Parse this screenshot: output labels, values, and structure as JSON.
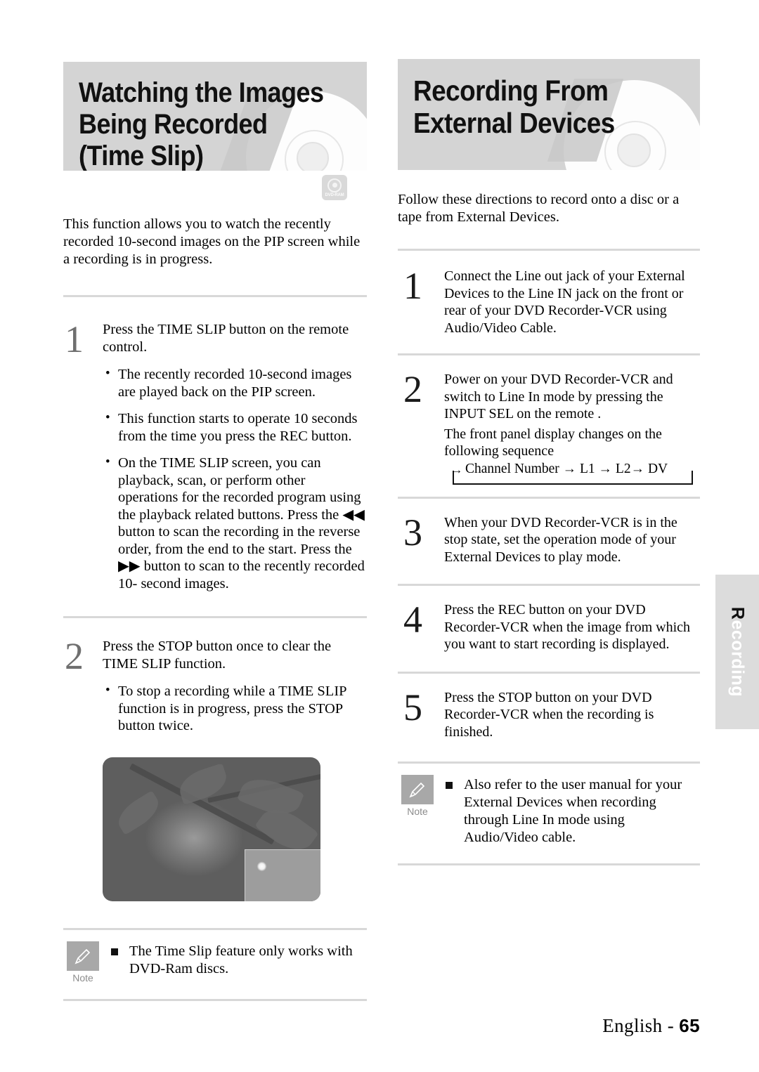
{
  "page": {
    "footer_prefix": "English - ",
    "footer_page": "65",
    "side_tab_text": "Recording",
    "side_tab_initial": "R",
    "side_tab_rest": "ecording"
  },
  "left": {
    "banner_title": "Watching the Images\nBeing Recorded (Time Slip)",
    "disc_badge": {
      "label": "DVD-RAM",
      "icon": "dvd-ram-disc-icon"
    },
    "intro": "This function allows you to watch the recently recorded 10-second images on the PIP screen while a recording is in progress.",
    "steps": [
      {
        "number": "1",
        "lead": "Press the TIME SLIP button on the remote control.",
        "bullets": [
          "The recently recorded 10-second images are played back on the PIP screen.",
          "This function starts to operate 10 seconds from the time you press the REC button.",
          "On the TIME SLIP screen, you can playback, scan, or perform other operations for the recorded program using the playback related buttons. Press the ◀◀ button to scan the recording in the reverse order, from the end to the start. Press the ▶▶ button to scan to the recently recorded  10- second images."
        ]
      },
      {
        "number": "2",
        "lead": "Press the STOP button once to clear the TIME SLIP function.",
        "bullets": [
          "To stop a recording while a TIME SLIP function is in progress, press the STOP button twice."
        ]
      }
    ],
    "photo": {
      "alt": "Grayscale photo of berries on a branch with PIP inset of white flowers",
      "pip_alt": "Picture-in-picture inset showing white flowers"
    },
    "note": {
      "label": "Note",
      "icon": "pencil-note-icon",
      "text": "The Time Slip feature only works with DVD-Ram discs."
    }
  },
  "right": {
    "banner_title": "Recording From\nExternal Devices",
    "intro": "Follow these directions to record onto a disc or a tape from External Devices.",
    "steps": [
      {
        "number": "1",
        "lead": "Connect the Line out jack of your External Devices to the Line IN jack on the front or rear of your DVD Recorder-VCR using Audio/Video Cable."
      },
      {
        "number": "2",
        "lead": "Power on your DVD Recorder-VCR and switch to Line In mode by pressing the INPUT SEL on the remote .",
        "lead2": "The front panel display changes on the following sequence",
        "sequence": "Channel Number →  L1 →  L2→  DV",
        "sequence_arrow": "→"
      },
      {
        "number": "3",
        "lead": "When your DVD Recorder-VCR is in the stop state, set the operation mode of your External Devices to play mode."
      },
      {
        "number": "4",
        "lead": "Press the REC button on your DVD Recorder-VCR when the image from which you want to start recording is displayed."
      },
      {
        "number": "5",
        "lead": "Press the STOP button on your DVD Recorder-VCR when the recording is finished."
      }
    ],
    "note": {
      "label": "Note",
      "icon": "pencil-note-icon",
      "text": "Also refer to the user manual for your External Devices when recording through Line In mode using Audio/Video cable."
    }
  }
}
